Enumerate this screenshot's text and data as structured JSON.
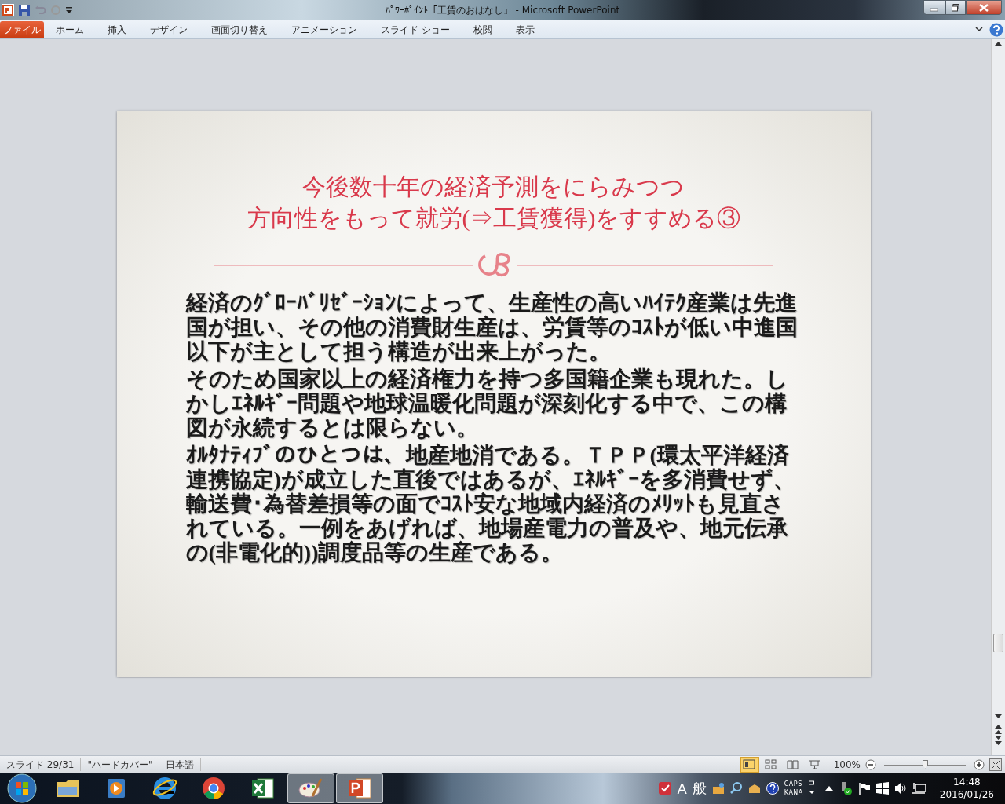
{
  "window": {
    "title": "ﾊﾟﾜｰﾎﾟｲﾝﾄ「工賃のおはなし」 - Microsoft PowerPoint"
  },
  "ribbon": {
    "tabs": [
      {
        "label": "ファイル",
        "kind": "file"
      },
      {
        "label": "ホーム",
        "kind": "tab"
      },
      {
        "label": "挿入",
        "kind": "tab"
      },
      {
        "label": "デザイン",
        "kind": "tab"
      },
      {
        "label": "画面切り替え",
        "kind": "tab"
      },
      {
        "label": "アニメーション",
        "kind": "tab"
      },
      {
        "label": "スライド ショー",
        "kind": "tab"
      },
      {
        "label": "校閲",
        "kind": "tab"
      },
      {
        "label": "表示",
        "kind": "tab"
      }
    ]
  },
  "slide": {
    "title_lines": [
      "今後数十年の経済予測をにらみつつ",
      "方向性をもって就労(⇒工賃獲得)をすすめる③"
    ],
    "paragraphs": [
      "経済のｸﾞﾛｰﾊﾞﾘｾﾞｰｼｮﾝによって、生産性の高いﾊｲﾃｸ産業は先進国が担い、その他の消費財生産は、労賃等のｺｽﾄが低い中進国以下が主として担う構造が出来上がった。",
      "そのため国家以上の経済権力を持つ多国籍企業も現れた。しかしｴﾈﾙｷﾞｰ問題や地球温暖化問題が深刻化する中で、この構図が永続するとは限らない。",
      "ｵﾙﾀﾅﾃｨﾌﾞのひとつは、地産地消である。ＴＰＰ(環太平洋経済連携協定)が成立した直後ではあるが、ｴﾈﾙｷﾞｰを多消費せず、輸送費･為替差損等の面でｺｽﾄ安な地域内経済のﾒﾘｯﾄも見直されている。一例をあげれば、地場産電力の普及や、地元伝承の(非電化的))調度品等の生産である。"
    ]
  },
  "status_bar": {
    "items": [
      "スライド 29/31",
      "\"ハードカバー\"",
      "日本語"
    ],
    "views": [
      {
        "kind": "normal",
        "selected": true
      },
      {
        "kind": "sorter",
        "selected": false
      },
      {
        "kind": "reading",
        "selected": false
      },
      {
        "kind": "show",
        "selected": false
      }
    ],
    "zoom": "100%",
    "zoom_slider": {
      "level": 0.5
    }
  },
  "taskbar": {
    "apps": [
      {
        "kind": "folder",
        "selected": false
      },
      {
        "kind": "media",
        "selected": false
      },
      {
        "kind": "browser-e",
        "selected": false
      },
      {
        "kind": "browser-c",
        "selected": false
      },
      {
        "kind": "sheet",
        "selected": false
      },
      {
        "kind": "paint",
        "selected": true
      },
      {
        "kind": "slides",
        "selected": true
      }
    ],
    "tray": {
      "ime_mode": "A",
      "ime_kanji": "般",
      "caps": "CAPS",
      "kana": "KANA",
      "time": "14:48",
      "date": "2016/01/26"
    }
  }
}
